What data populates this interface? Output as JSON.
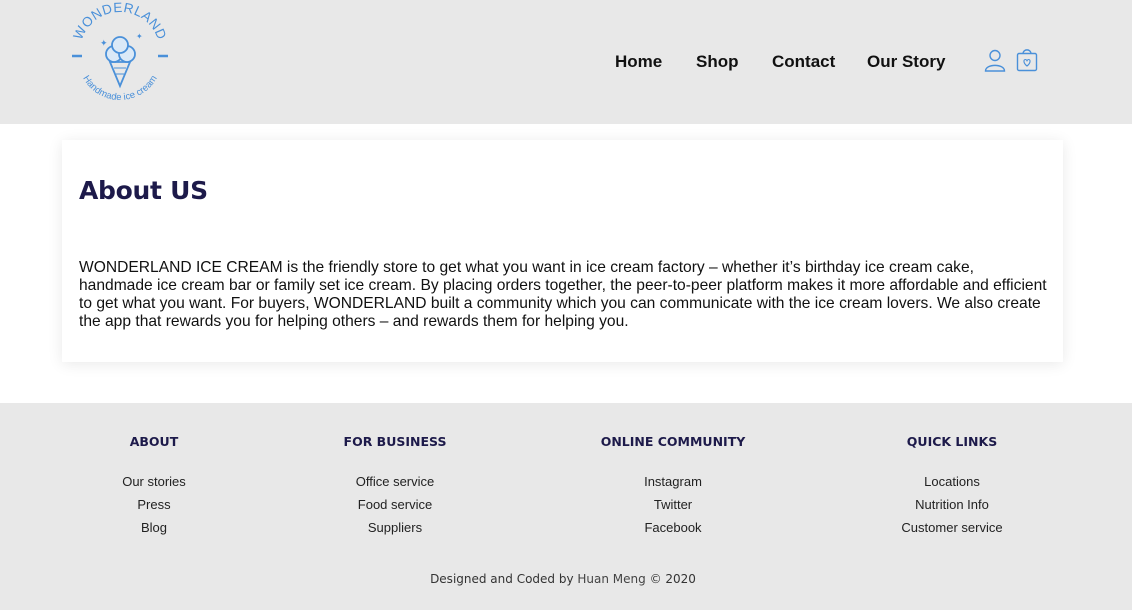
{
  "header": {
    "logo": {
      "brand_text": "WONDERLAND",
      "tagline": "Handmade ice cream",
      "icon": "ice-cream-cone-icon",
      "color": "#4a90d9"
    },
    "nav": [
      {
        "label": "Home"
      },
      {
        "label": "Shop"
      },
      {
        "label": "Contact"
      },
      {
        "label": "Our Story"
      }
    ],
    "icons": {
      "account": "user-icon",
      "cart": "shopping-bag-icon",
      "color": "#4a90d9"
    }
  },
  "main": {
    "title": "About US",
    "body": "WONDERLAND ICE CREAM is the friendly store to get what you want in ice cream factory – whether it’s birthday ice cream cake, handmade ice cream bar or family set ice cream. By placing orders together, the peer-to-peer platform makes it more affordable and efficient to get what you want. For buyers, WONDERLAND built a community which you can communicate with the ice cream lovers. We also create the app that rewards you for helping others – and rewards them for helping you."
  },
  "footer": {
    "columns": [
      {
        "title": "ABOUT",
        "links": [
          "Our stories",
          "Press",
          "Blog"
        ]
      },
      {
        "title": "FOR BUSINESS",
        "links": [
          "Office service",
          "Food service",
          "Suppliers"
        ]
      },
      {
        "title": "ONLINE COMMUNITY",
        "links": [
          "Instagram",
          "Twitter",
          "Facebook"
        ]
      },
      {
        "title": "QUICK LINKS",
        "links": [
          "Locations",
          "Nutrition Info",
          "Customer service"
        ]
      }
    ],
    "credit_prefix": "Designed and Coded by ",
    "credit_author": "Huan Meng",
    "credit_suffix": " © 2020"
  },
  "colors": {
    "header_bg": "#e8e8e8",
    "footer_bg": "#e8e8e8",
    "heading": "#1d1a4a",
    "accent": "#4a90d9"
  }
}
